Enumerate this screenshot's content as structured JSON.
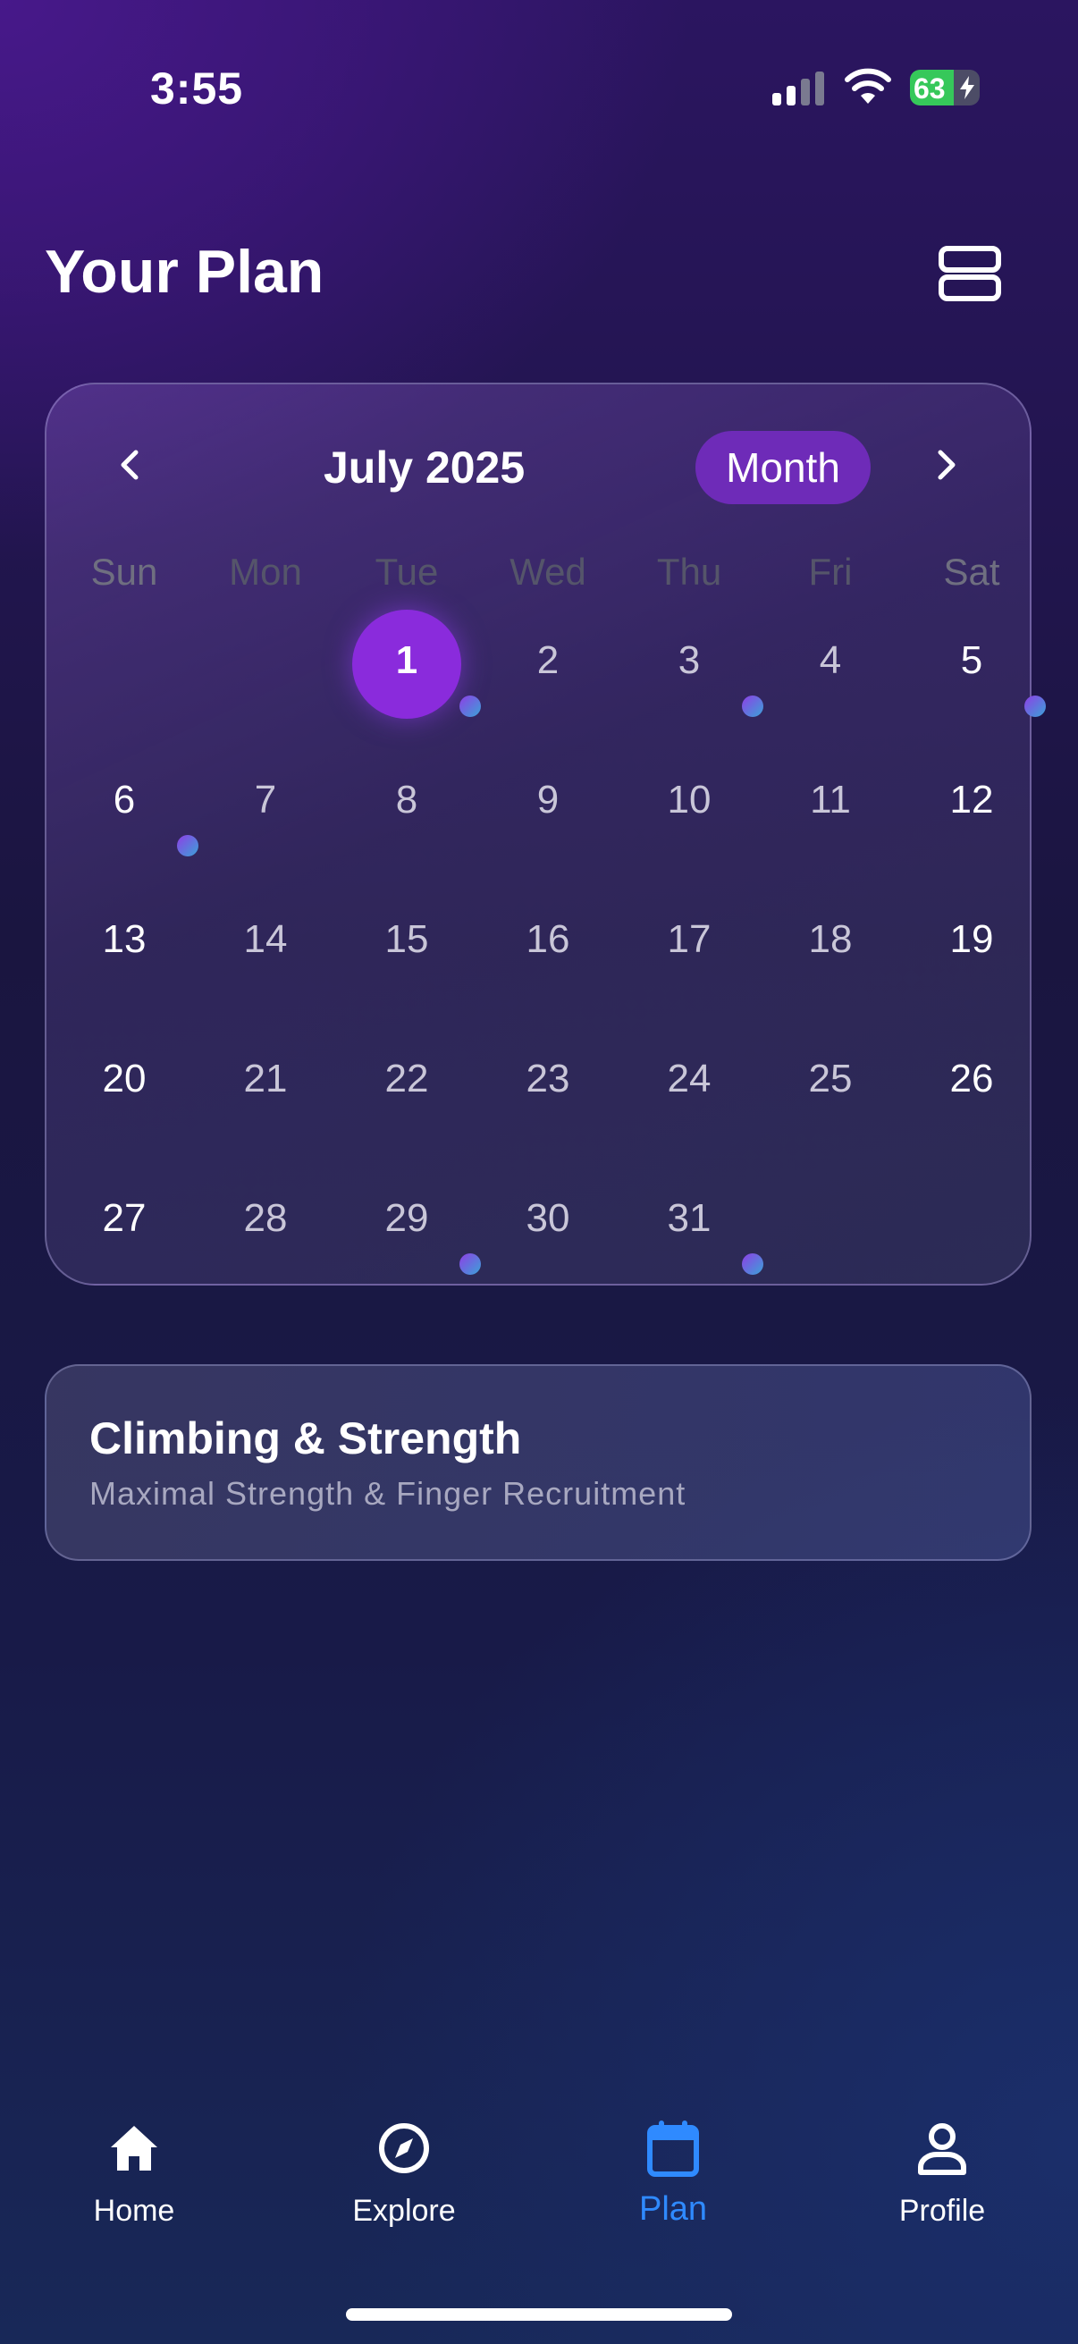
{
  "status": {
    "time": "3:55",
    "battery": "63",
    "battery_level": 0.63
  },
  "header": {
    "title": "Your Plan",
    "layout_icon": "stacked-rows-icon"
  },
  "calendar": {
    "month_label": "July 2025",
    "view_mode": "Month",
    "prev_icon": "chevron-left-icon",
    "next_icon": "chevron-right-icon",
    "weekdays": [
      "Sun",
      "Mon",
      "Tue",
      "Wed",
      "Thu",
      "Fri",
      "Sat"
    ],
    "today": "1",
    "days": [
      "1",
      "2",
      "3",
      "4",
      "5",
      "6",
      "7",
      "8",
      "9",
      "10",
      "11",
      "12",
      "13",
      "14",
      "15",
      "16",
      "17",
      "18",
      "19",
      "20",
      "21",
      "22",
      "23",
      "24",
      "25",
      "26",
      "27",
      "28",
      "29",
      "30",
      "31"
    ],
    "marked_days": [
      1,
      3,
      5,
      6,
      29,
      31
    ]
  },
  "workout": {
    "title": "Climbing & Strength",
    "subtitle": "Maximal Strength & Finger Recruitment"
  },
  "tabs": [
    {
      "label": "Home",
      "icon": "home-icon"
    },
    {
      "label": "Explore",
      "icon": "compass-icon"
    },
    {
      "label": "Plan",
      "icon": "calendar-icon"
    },
    {
      "label": "Profile",
      "icon": "person-icon"
    }
  ],
  "colors": {
    "accent": "#8a2bdc",
    "pill": "#6e2bb8",
    "active_tab": "#2f8aff",
    "battery": "#36c85a"
  }
}
